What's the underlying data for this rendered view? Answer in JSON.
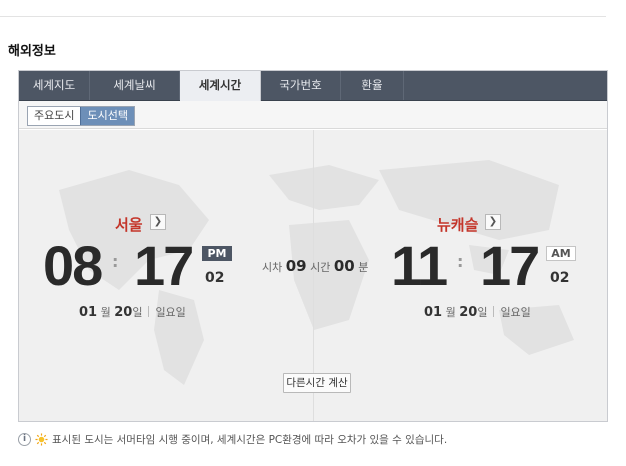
{
  "section_title": "해외정보",
  "tabs": [
    {
      "label": "세계지도"
    },
    {
      "label": "세계날씨"
    },
    {
      "label": "세계시간"
    },
    {
      "label": "국가번호"
    },
    {
      "label": "환율"
    }
  ],
  "active_tab_index": 2,
  "segment": {
    "major_cities": "주요도시",
    "select_city": "도시선택"
  },
  "left_clock": {
    "city": "서울",
    "hour": "08",
    "minute": "17",
    "ampm": "PM",
    "second": "02",
    "month": "01",
    "month_unit": "월",
    "day": "20",
    "day_unit": "일",
    "weekday": "일요일"
  },
  "right_clock": {
    "city": "뉴캐슬",
    "hour": "11",
    "minute": "17",
    "ampm": "AM",
    "second": "02",
    "month": "01",
    "month_unit": "월",
    "day": "20",
    "day_unit": "일",
    "weekday": "일요일"
  },
  "time_diff": {
    "prefix": "시차",
    "hours": "09",
    "hours_unit": "시간",
    "minutes": "00",
    "minutes_unit": "분"
  },
  "calc_button_label": "다른시간 계산",
  "notice_text": "표시된 도시는 서머타임 시행 중이며, 세계시간은 PC환경에 따라 오차가 있을 수 있습니다.",
  "colors": {
    "tab_bar": "#4d5664",
    "city_red": "#c4352a",
    "seg_active": "#6d8fb8"
  }
}
